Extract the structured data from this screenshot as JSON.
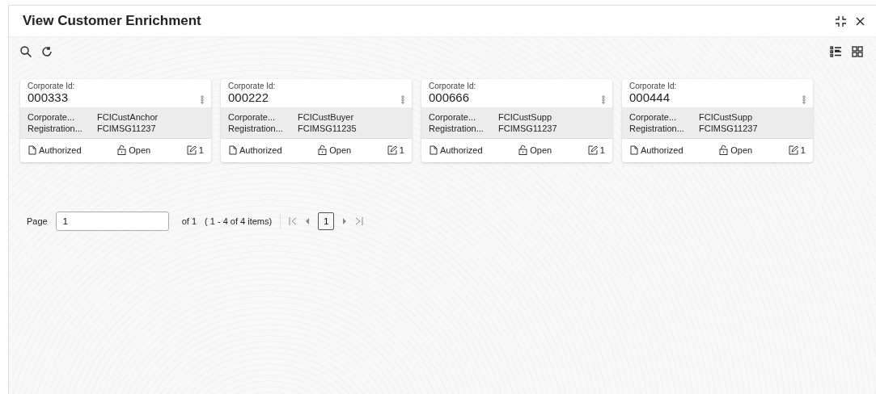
{
  "window": {
    "title": "View Customer Enrichment"
  },
  "cards": [
    {
      "id_label": "Corporate Id:",
      "id": "000333",
      "fields": [
        {
          "label": "Corporate...",
          "value": "FCICustAnchor"
        },
        {
          "label": "Registration...",
          "value": "FCIMSG11237"
        }
      ],
      "status": "Authorized",
      "lock": "Open",
      "edits": "1"
    },
    {
      "id_label": "Corporate Id:",
      "id": "000222",
      "fields": [
        {
          "label": "Corporate...",
          "value": "FCICustBuyer"
        },
        {
          "label": "Registration...",
          "value": "FCIMSG11235"
        }
      ],
      "status": "Authorized",
      "lock": "Open",
      "edits": "1"
    },
    {
      "id_label": "Corporate Id:",
      "id": "000666",
      "fields": [
        {
          "label": "Corporate...",
          "value": "FCICustSupp"
        },
        {
          "label": "Registration...",
          "value": "FCIMSG11237"
        }
      ],
      "status": "Authorized",
      "lock": "Open",
      "edits": "1"
    },
    {
      "id_label": "Corporate Id:",
      "id": "000444",
      "fields": [
        {
          "label": "Corporate...",
          "value": "FCICustSupp"
        },
        {
          "label": "Registration...",
          "value": "FCIMSG11237"
        }
      ],
      "status": "Authorized",
      "lock": "Open",
      "edits": "1"
    }
  ],
  "pagination": {
    "label": "Page",
    "value": "1",
    "of": "of 1",
    "items": "( 1 - 4 of 4 items)",
    "pages": [
      {
        "label": "1",
        "selected": true
      }
    ]
  }
}
